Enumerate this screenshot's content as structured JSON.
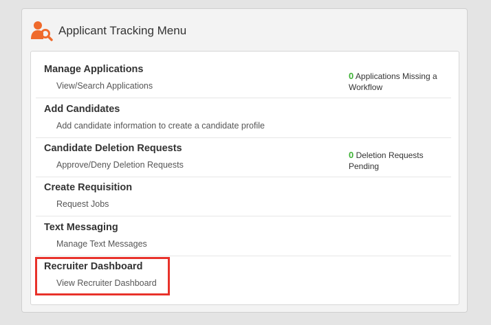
{
  "panel": {
    "title": "Applicant Tracking Menu",
    "icon": "applicant-search-icon",
    "icon_color": "#ef6a2c"
  },
  "menu": {
    "items": [
      {
        "title": "Manage Applications",
        "subtitle": "View/Search Applications",
        "status": {
          "count": "0",
          "text": "Applications Missing a Workflow"
        }
      },
      {
        "title": "Add Candidates",
        "subtitle": "Add candidate information to create a candidate profile"
      },
      {
        "title": "Candidate Deletion Requests",
        "subtitle": "Approve/Deny Deletion Requests",
        "status": {
          "count": "0",
          "text": "Deletion Requests Pending"
        }
      },
      {
        "title": "Create Requisition",
        "subtitle": "Request Jobs"
      },
      {
        "title": "Text Messaging",
        "subtitle": "Manage Text Messages"
      },
      {
        "title": "Recruiter Dashboard",
        "subtitle": "View Recruiter Dashboard"
      }
    ]
  },
  "colors": {
    "status_count": "#3cb034",
    "highlight_border": "#e8312a"
  }
}
